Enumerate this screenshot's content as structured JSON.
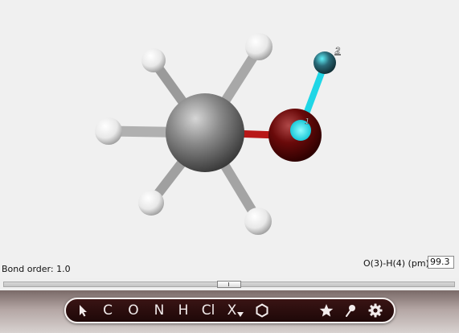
{
  "atom_labels": {
    "oxygen_index": "1",
    "hydrogen_index": "2"
  },
  "status": {
    "bond_order": "Bond order: 1.0",
    "bond_length_label": "O(3)-H(4) (pm):",
    "bond_length_value": "99.3"
  },
  "toolbar": {
    "tools": [
      {
        "name": "select-tool",
        "label": ""
      },
      {
        "name": "carbon-tool",
        "label": "C"
      },
      {
        "name": "oxygen-tool",
        "label": "O"
      },
      {
        "name": "nitrogen-tool",
        "label": "N"
      },
      {
        "name": "hydrogen-tool",
        "label": "H"
      },
      {
        "name": "chlorine-tool",
        "label": "Cl"
      },
      {
        "name": "halogen-menu-tool",
        "label": "X"
      },
      {
        "name": "ring-tool",
        "label": ""
      },
      {
        "name": "favorites-tool",
        "label": ""
      },
      {
        "name": "measure-tool",
        "label": ""
      },
      {
        "name": "settings-tool",
        "label": ""
      }
    ]
  },
  "colors": {
    "carbon": "#7a7a7a",
    "oxygen": "#6a0a0a",
    "hydrogen": "#ffffff",
    "selected_bond": "#20d8e8",
    "toolbar_bg": "#2a0e0e"
  }
}
